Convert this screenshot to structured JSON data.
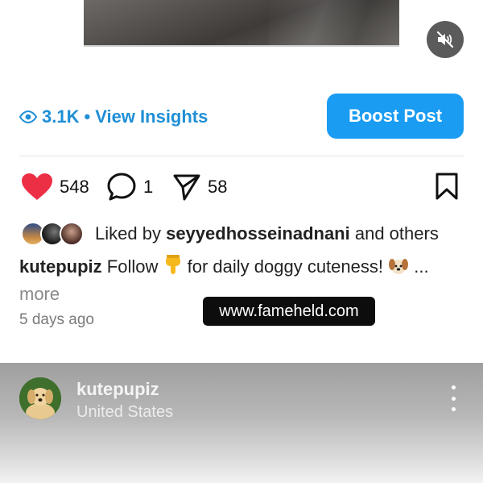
{
  "post": {
    "insights": {
      "views": "3.1K",
      "separator": "•",
      "link_label": "View Insights"
    },
    "boost_label": "Boost Post",
    "actions": {
      "likes": "548",
      "comments": "1",
      "shares": "58"
    },
    "liked_by": {
      "prefix": "Liked by",
      "user": "seyyedhosseinadnani",
      "suffix": "and others"
    },
    "caption": {
      "username": "kutepupiz",
      "text_before": "Follow",
      "text_after": "for daily doggy cuteness!",
      "ellipsis": "...",
      "more": "more"
    },
    "time_ago": "5 days ago"
  },
  "watermark": "www.fameheld.com",
  "next_post": {
    "username": "kutepupiz",
    "location": "United States"
  },
  "colors": {
    "accent": "#1a9cf2",
    "link": "#1f8fd6",
    "like": "#ed2f45"
  },
  "icons": [
    "mute-icon",
    "eye-icon",
    "heart-icon",
    "comment-icon",
    "share-icon",
    "bookmark-icon",
    "pointing-down-emoji",
    "dog-emoji",
    "more-icon"
  ]
}
